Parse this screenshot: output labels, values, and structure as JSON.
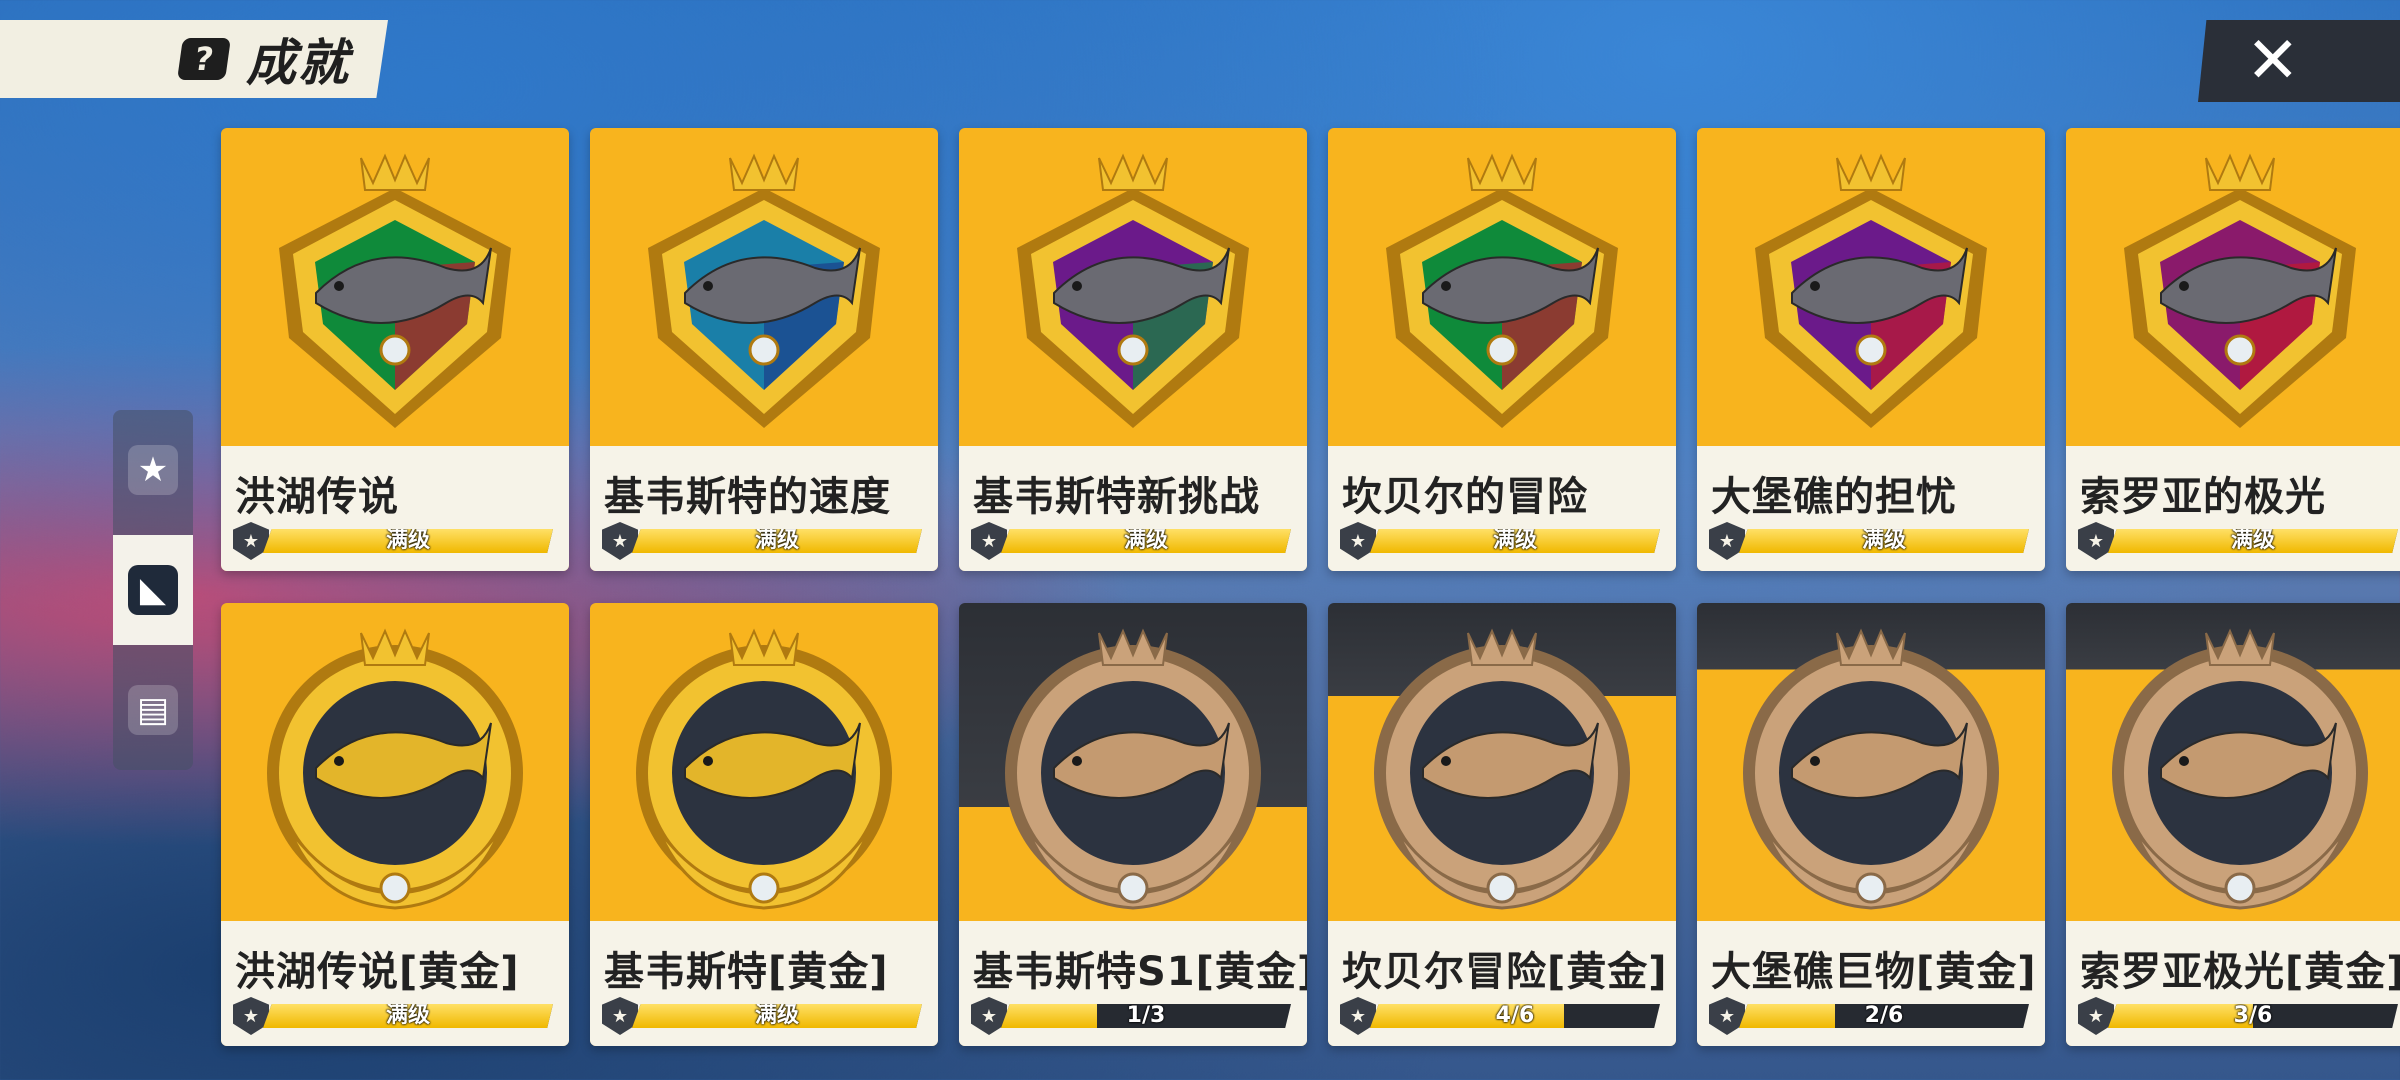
{
  "header": {
    "title": "成就",
    "icon": "?"
  },
  "close": {
    "glyph": "✕"
  },
  "side_tabs": [
    {
      "icon": "shield-star-icon",
      "glyph": "★",
      "active": false
    },
    {
      "icon": "shark-fin-icon",
      "glyph": "◣",
      "active": true
    },
    {
      "icon": "map-book-icon",
      "glyph": "▤",
      "active": false
    }
  ],
  "achievements": [
    {
      "name": "洪湖传说",
      "progress_text": "满级",
      "progress": 1.0,
      "fish": "carp",
      "colors": [
        "#0f8a3a",
        "#c0192e"
      ]
    },
    {
      "name": "基韦斯特的速度",
      "progress_text": "满级",
      "progress": 1.0,
      "fish": "swordfish",
      "colors": [
        "#1a7fa8",
        "#1d3e8a"
      ]
    },
    {
      "name": "基韦斯特新挑战",
      "progress_text": "满级",
      "progress": 1.0,
      "fish": "marlin",
      "colors": [
        "#6b1a8a",
        "#0f8a3a"
      ]
    },
    {
      "name": "坎贝尔的冒险",
      "progress_text": "满级",
      "progress": 1.0,
      "fish": "sturgeon",
      "colors": [
        "#0f8a3a",
        "#c0192e"
      ]
    },
    {
      "name": "大堡礁的担忧",
      "progress_text": "满级",
      "progress": 1.0,
      "fish": "shark",
      "colors": [
        "#6b1a8a",
        "#c0192e"
      ]
    },
    {
      "name": "索罗亚的极光",
      "progress_text": "满级",
      "progress": 1.0,
      "fish": "greenland-shark",
      "colors": [
        "#8a1a6b",
        "#c0192e"
      ]
    },
    {
      "name": "洪湖传说[黄金]",
      "progress_text": "满级",
      "progress": 1.0,
      "fish": "gold-carp",
      "colors": [
        "#2c3340",
        "#e8b020"
      ]
    },
    {
      "name": "基韦斯特[黄金]",
      "progress_text": "满级",
      "progress": 1.0,
      "fish": "gold-swordfish",
      "colors": [
        "#2c3340",
        "#e8b020"
      ]
    },
    {
      "name": "基韦斯特S1[黄金]",
      "progress_text": "1/3",
      "progress": 0.333,
      "fish": "bronze-marlin",
      "colors": [
        "#2c3340",
        "#b58a5a"
      ]
    },
    {
      "name": "坎贝尔冒险[黄金]",
      "progress_text": "4/6",
      "progress": 0.667,
      "fish": "bronze-fish",
      "colors": [
        "#2c3340",
        "#b58a5a"
      ]
    },
    {
      "name": "大堡礁巨物[黄金]",
      "progress_text": "2/6",
      "progress": 0.333,
      "fish": "bronze-shark",
      "colors": [
        "#2c3340",
        "#b58a5a"
      ]
    },
    {
      "name": "索罗亚极光[黄金]",
      "progress_text": "3/6",
      "progress": 0.5,
      "fish": "bronze-greenland-shark",
      "colors": [
        "#2c3340",
        "#b58a5a"
      ]
    }
  ]
}
